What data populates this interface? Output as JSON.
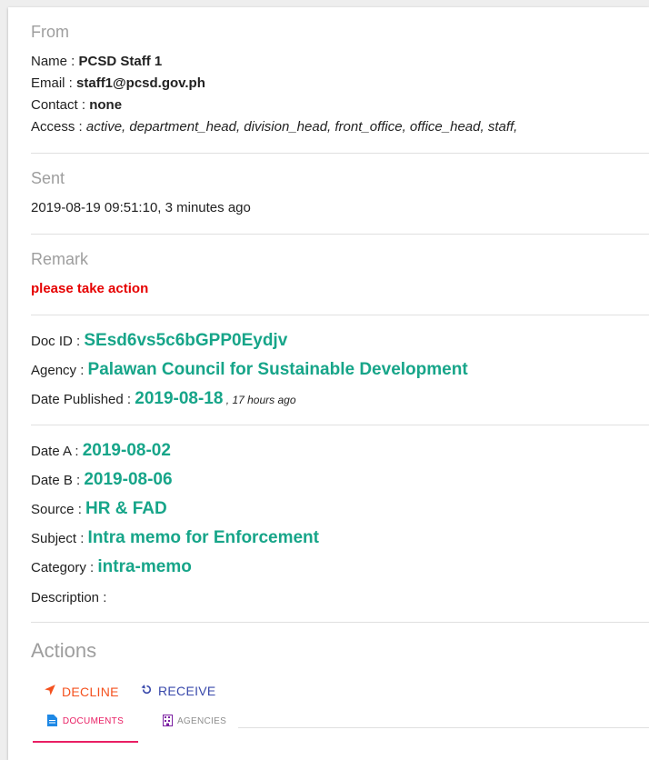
{
  "from": {
    "heading": "From",
    "name_label": "Name : ",
    "name_value": "PCSD Staff 1",
    "email_label": "Email : ",
    "email_value": "staff1@pcsd.gov.ph",
    "contact_label": "Contact : ",
    "contact_value": "none",
    "access_label": "Access : ",
    "access_value": "active, department_head, division_head, front_office, office_head, staff,"
  },
  "sent": {
    "heading": "Sent",
    "value": "2019-08-19 09:51:10, 3 minutes ago"
  },
  "remark": {
    "heading": "Remark",
    "value": "please take action"
  },
  "doc": {
    "id_label": "Doc ID : ",
    "id_value": "SEsd6vs5c6bGPP0Eydjv",
    "agency_label": "Agency : ",
    "agency_value": "Palawan Council for Sustainable Development",
    "published_label": "Date Published : ",
    "published_value": "2019-08-18",
    "published_ago": " , 17 hours ago"
  },
  "details": {
    "date_a_label": "Date A : ",
    "date_a_value": "2019-08-02",
    "date_b_label": "Date B : ",
    "date_b_value": "2019-08-06",
    "source_label": "Source : ",
    "source_value": "HR & FAD",
    "subject_label": "Subject : ",
    "subject_value": "Intra memo for Enforcement",
    "category_label": "Category : ",
    "category_value": "intra-memo",
    "description_label": "Description :"
  },
  "actions": {
    "heading": "Actions",
    "decline_label": "DECLINE",
    "receive_label": "RECEIVE"
  },
  "tabs": {
    "documents_label": "DOCUMENTS",
    "agencies_label": "AGENCIES"
  },
  "colors": {
    "accent_teal": "#17a589",
    "remark_red": "#e60000",
    "decline_orange": "#f4511e",
    "receive_indigo": "#3949ab",
    "tab_active_pink": "#e91e63"
  }
}
